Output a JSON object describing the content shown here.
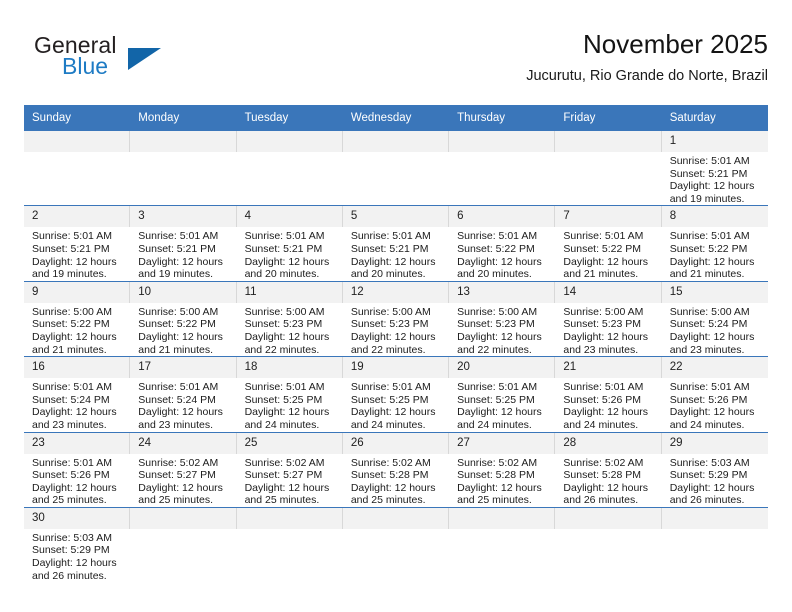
{
  "brand": {
    "word1": "General",
    "word2": "Blue",
    "triangle_color": "#1265a8",
    "blue_text_color": "#1e7bc4"
  },
  "header": {
    "title": "November 2025",
    "subtitle": "Jucurutu, Rio Grande do Norte, Brazil"
  },
  "theme": {
    "header_blue": "#3a76ba",
    "daynum_bg": "#f2f2f2",
    "grid_line": "#3a76ba"
  },
  "calendar": {
    "weekday_headers": [
      "Sunday",
      "Monday",
      "Tuesday",
      "Wednesday",
      "Thursday",
      "Friday",
      "Saturday"
    ],
    "weeks": [
      [
        {
          "day": "",
          "lines": []
        },
        {
          "day": "",
          "lines": []
        },
        {
          "day": "",
          "lines": []
        },
        {
          "day": "",
          "lines": []
        },
        {
          "day": "",
          "lines": []
        },
        {
          "day": "",
          "lines": []
        },
        {
          "day": "1",
          "lines": [
            "Sunrise: 5:01 AM",
            "Sunset: 5:21 PM",
            "Daylight: 12 hours",
            "and 19 minutes."
          ]
        }
      ],
      [
        {
          "day": "2",
          "lines": [
            "Sunrise: 5:01 AM",
            "Sunset: 5:21 PM",
            "Daylight: 12 hours",
            "and 19 minutes."
          ]
        },
        {
          "day": "3",
          "lines": [
            "Sunrise: 5:01 AM",
            "Sunset: 5:21 PM",
            "Daylight: 12 hours",
            "and 19 minutes."
          ]
        },
        {
          "day": "4",
          "lines": [
            "Sunrise: 5:01 AM",
            "Sunset: 5:21 PM",
            "Daylight: 12 hours",
            "and 20 minutes."
          ]
        },
        {
          "day": "5",
          "lines": [
            "Sunrise: 5:01 AM",
            "Sunset: 5:21 PM",
            "Daylight: 12 hours",
            "and 20 minutes."
          ]
        },
        {
          "day": "6",
          "lines": [
            "Sunrise: 5:01 AM",
            "Sunset: 5:22 PM",
            "Daylight: 12 hours",
            "and 20 minutes."
          ]
        },
        {
          "day": "7",
          "lines": [
            "Sunrise: 5:01 AM",
            "Sunset: 5:22 PM",
            "Daylight: 12 hours",
            "and 21 minutes."
          ]
        },
        {
          "day": "8",
          "lines": [
            "Sunrise: 5:01 AM",
            "Sunset: 5:22 PM",
            "Daylight: 12 hours",
            "and 21 minutes."
          ]
        }
      ],
      [
        {
          "day": "9",
          "lines": [
            "Sunrise: 5:00 AM",
            "Sunset: 5:22 PM",
            "Daylight: 12 hours",
            "and 21 minutes."
          ]
        },
        {
          "day": "10",
          "lines": [
            "Sunrise: 5:00 AM",
            "Sunset: 5:22 PM",
            "Daylight: 12 hours",
            "and 21 minutes."
          ]
        },
        {
          "day": "11",
          "lines": [
            "Sunrise: 5:00 AM",
            "Sunset: 5:23 PM",
            "Daylight: 12 hours",
            "and 22 minutes."
          ]
        },
        {
          "day": "12",
          "lines": [
            "Sunrise: 5:00 AM",
            "Sunset: 5:23 PM",
            "Daylight: 12 hours",
            "and 22 minutes."
          ]
        },
        {
          "day": "13",
          "lines": [
            "Sunrise: 5:00 AM",
            "Sunset: 5:23 PM",
            "Daylight: 12 hours",
            "and 22 minutes."
          ]
        },
        {
          "day": "14",
          "lines": [
            "Sunrise: 5:00 AM",
            "Sunset: 5:23 PM",
            "Daylight: 12 hours",
            "and 23 minutes."
          ]
        },
        {
          "day": "15",
          "lines": [
            "Sunrise: 5:00 AM",
            "Sunset: 5:24 PM",
            "Daylight: 12 hours",
            "and 23 minutes."
          ]
        }
      ],
      [
        {
          "day": "16",
          "lines": [
            "Sunrise: 5:01 AM",
            "Sunset: 5:24 PM",
            "Daylight: 12 hours",
            "and 23 minutes."
          ]
        },
        {
          "day": "17",
          "lines": [
            "Sunrise: 5:01 AM",
            "Sunset: 5:24 PM",
            "Daylight: 12 hours",
            "and 23 minutes."
          ]
        },
        {
          "day": "18",
          "lines": [
            "Sunrise: 5:01 AM",
            "Sunset: 5:25 PM",
            "Daylight: 12 hours",
            "and 24 minutes."
          ]
        },
        {
          "day": "19",
          "lines": [
            "Sunrise: 5:01 AM",
            "Sunset: 5:25 PM",
            "Daylight: 12 hours",
            "and 24 minutes."
          ]
        },
        {
          "day": "20",
          "lines": [
            "Sunrise: 5:01 AM",
            "Sunset: 5:25 PM",
            "Daylight: 12 hours",
            "and 24 minutes."
          ]
        },
        {
          "day": "21",
          "lines": [
            "Sunrise: 5:01 AM",
            "Sunset: 5:26 PM",
            "Daylight: 12 hours",
            "and 24 minutes."
          ]
        },
        {
          "day": "22",
          "lines": [
            "Sunrise: 5:01 AM",
            "Sunset: 5:26 PM",
            "Daylight: 12 hours",
            "and 24 minutes."
          ]
        }
      ],
      [
        {
          "day": "23",
          "lines": [
            "Sunrise: 5:01 AM",
            "Sunset: 5:26 PM",
            "Daylight: 12 hours",
            "and 25 minutes."
          ]
        },
        {
          "day": "24",
          "lines": [
            "Sunrise: 5:02 AM",
            "Sunset: 5:27 PM",
            "Daylight: 12 hours",
            "and 25 minutes."
          ]
        },
        {
          "day": "25",
          "lines": [
            "Sunrise: 5:02 AM",
            "Sunset: 5:27 PM",
            "Daylight: 12 hours",
            "and 25 minutes."
          ]
        },
        {
          "day": "26",
          "lines": [
            "Sunrise: 5:02 AM",
            "Sunset: 5:28 PM",
            "Daylight: 12 hours",
            "and 25 minutes."
          ]
        },
        {
          "day": "27",
          "lines": [
            "Sunrise: 5:02 AM",
            "Sunset: 5:28 PM",
            "Daylight: 12 hours",
            "and 25 minutes."
          ]
        },
        {
          "day": "28",
          "lines": [
            "Sunrise: 5:02 AM",
            "Sunset: 5:28 PM",
            "Daylight: 12 hours",
            "and 26 minutes."
          ]
        },
        {
          "day": "29",
          "lines": [
            "Sunrise: 5:03 AM",
            "Sunset: 5:29 PM",
            "Daylight: 12 hours",
            "and 26 minutes."
          ]
        }
      ],
      [
        {
          "day": "30",
          "lines": [
            "Sunrise: 5:03 AM",
            "Sunset: 5:29 PM",
            "Daylight: 12 hours",
            "and 26 minutes."
          ]
        },
        {
          "day": "",
          "lines": []
        },
        {
          "day": "",
          "lines": []
        },
        {
          "day": "",
          "lines": []
        },
        {
          "day": "",
          "lines": []
        },
        {
          "day": "",
          "lines": []
        },
        {
          "day": "",
          "lines": []
        }
      ]
    ]
  }
}
